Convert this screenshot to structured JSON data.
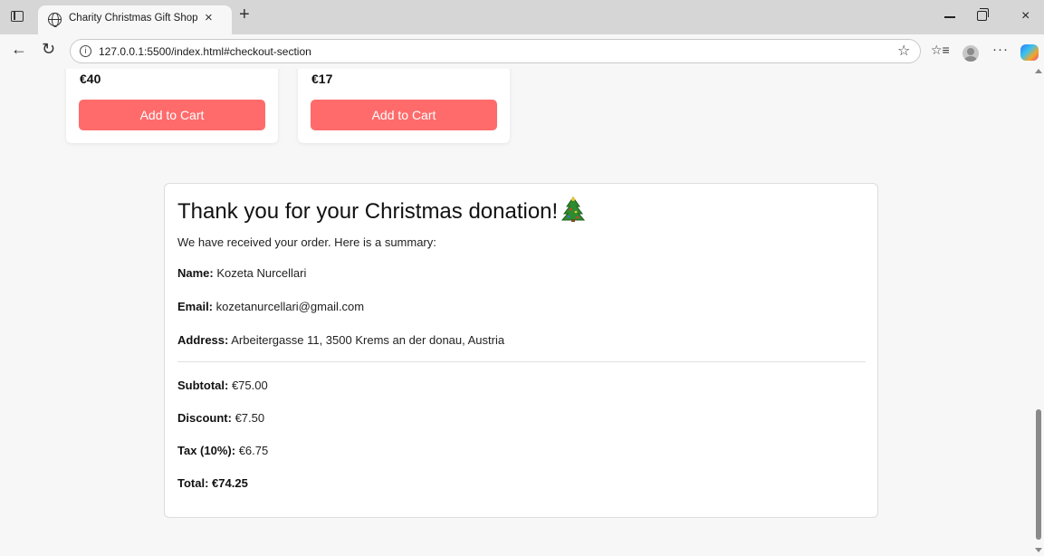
{
  "browser": {
    "tab_title": "Charity Christmas Gift Shop",
    "tab_close": "×",
    "new_tab": "+",
    "url": "127.0.0.1:5500/index.html#checkout-section",
    "window_close": "×",
    "more": "···"
  },
  "products": [
    {
      "price": "€40",
      "button_label": "Add to Cart"
    },
    {
      "price": "€17",
      "button_label": "Add to Cart"
    }
  ],
  "summary": {
    "heading": "Thank you for your Christmas donation!",
    "intro": "We have received your order. Here is a summary:",
    "name_label": "Name:",
    "name_value": "Kozeta Nurcellari",
    "email_label": "Email:",
    "email_value": "kozetanurcellari@gmail.com",
    "address_label": "Address:",
    "address_value": "Arbeitergasse 11, 3500 Krems an der donau, Austria",
    "subtotal_label": "Subtotal:",
    "subtotal_value": "€75.00",
    "discount_label": "Discount:",
    "discount_value": "€7.50",
    "tax_label": "Tax (10%):",
    "tax_value": "€6.75",
    "total_label": "Total:",
    "total_value": "€74.25"
  },
  "colors": {
    "button": "#ff6b6b",
    "page_background": "#f7f7f8",
    "tab_strip": "#d6d6d6"
  },
  "icons": {
    "tab_favicon": "globe-icon",
    "heading_emoji": "christmas-tree-icon"
  }
}
